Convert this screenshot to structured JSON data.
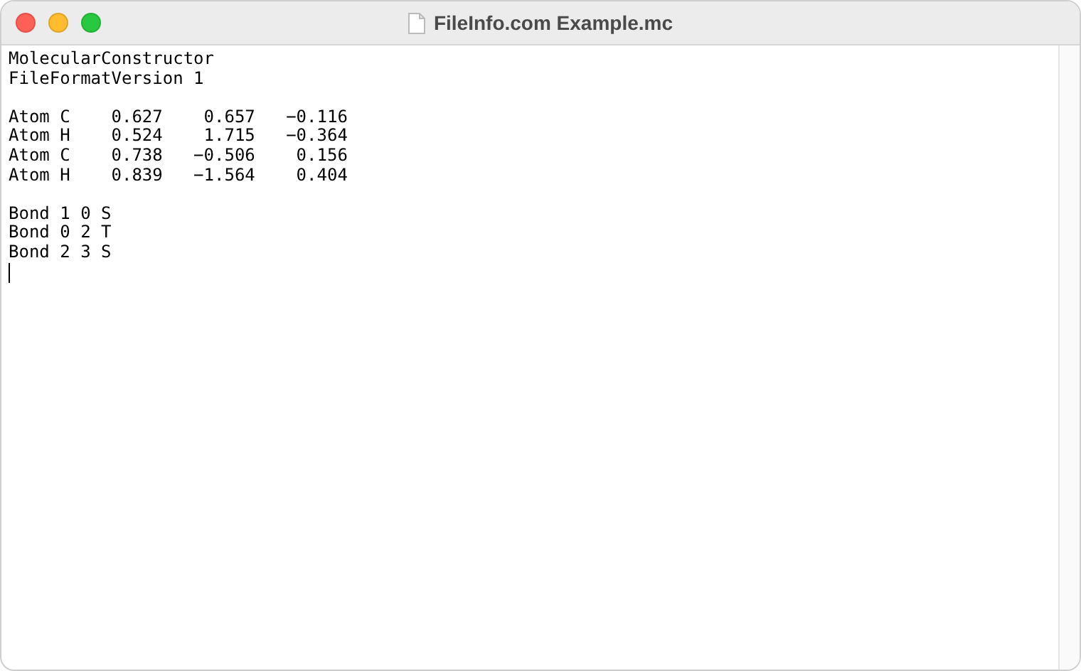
{
  "window": {
    "title": "FileInfo.com Example.mc"
  },
  "document": {
    "blocks": [
      [
        "MolecularConstructor",
        "FileFormatVersion 1"
      ],
      [
        "Atom C    0.627    0.657   −0.116",
        "Atom H    0.524    1.715   −0.364",
        "Atom C    0.738   −0.506    0.156",
        "Atom H    0.839   −1.564    0.404"
      ],
      [
        "Bond 1 0 S",
        "Bond 0 2 T",
        "Bond 2 3 S"
      ]
    ]
  }
}
